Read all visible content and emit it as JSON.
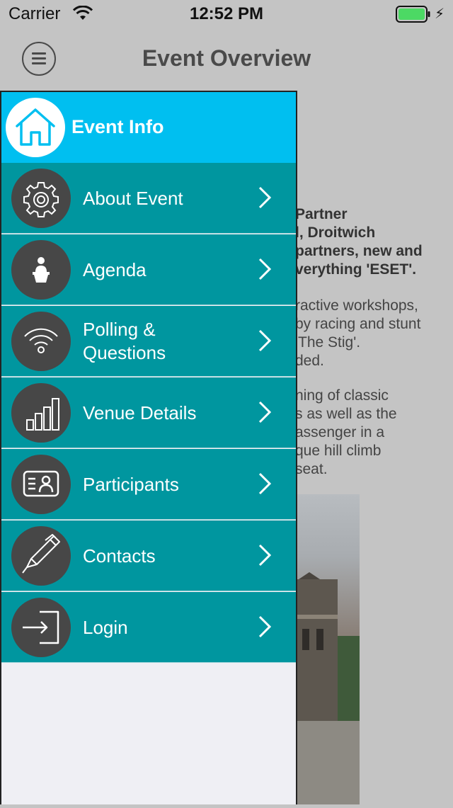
{
  "status_bar": {
    "carrier": "Carrier",
    "time": "12:52 PM",
    "battery_level": 1.0,
    "battery_color": "#4cd964"
  },
  "header": {
    "title": "Event Overview",
    "menu_icon": "hamburger-icon"
  },
  "background_content": {
    "bold_lines": [
      "Partner",
      "l, Droitwich",
      "partners, new and",
      "verything 'ESET'."
    ],
    "text_lines_1": [
      "ractive workshops,",
      "by racing and stunt",
      "'The Stig'.",
      "ded."
    ],
    "text_lines_2": [
      "ning of classic",
      "s as well as the",
      "assenger in a",
      "que hill climb",
      "seat."
    ]
  },
  "drawer": {
    "header_title": "Event Info",
    "header_icon": "home-icon",
    "header_color": "#00bff0",
    "item_color": "#00969f",
    "items": [
      {
        "label": "About Event",
        "icon": "gear-icon"
      },
      {
        "label": "Agenda",
        "icon": "podium-speaker-icon"
      },
      {
        "label": "Polling &\nQuestions",
        "icon": "wifi-signal-icon"
      },
      {
        "label": "Venue Details",
        "icon": "bar-chart-icon"
      },
      {
        "label": "Participants",
        "icon": "id-card-icon"
      },
      {
        "label": "Contacts",
        "icon": "pen-icon"
      },
      {
        "label": "Login",
        "icon": "login-icon"
      }
    ]
  }
}
